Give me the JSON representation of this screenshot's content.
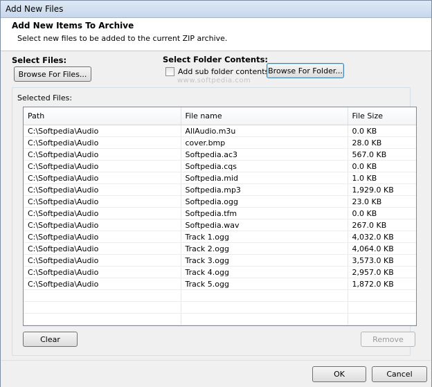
{
  "window": {
    "title": "Add New Files"
  },
  "header": {
    "title": "Add New Items To Archive",
    "subtitle": "Select new files to be added to the current ZIP archive."
  },
  "select_files": {
    "label": "Select Files:",
    "browse_files_label": "Browse For Files..."
  },
  "select_folder": {
    "label": "Select Folder Contents:",
    "subfolder_checkbox_label": "Add sub folder contents",
    "subfolder_checked": false,
    "browse_folder_label": "Browse For Folder..."
  },
  "watermark": "www.softpedia.com",
  "selected_files": {
    "label": "Selected Files:",
    "columns": [
      "Path",
      "File name",
      "File Size"
    ],
    "rows": [
      [
        "C:\\Softpedia\\Audio",
        "AllAudio.m3u",
        "0.0 KB"
      ],
      [
        "C:\\Softpedia\\Audio",
        "cover.bmp",
        "28.0 KB"
      ],
      [
        "C:\\Softpedia\\Audio",
        "Softpedia.ac3",
        "567.0 KB"
      ],
      [
        "C:\\Softpedia\\Audio",
        "Softpedia.cqs",
        "0.0 KB"
      ],
      [
        "C:\\Softpedia\\Audio",
        "Softpedia.mid",
        "1.0 KB"
      ],
      [
        "C:\\Softpedia\\Audio",
        "Softpedia.mp3",
        "1,929.0 KB"
      ],
      [
        "C:\\Softpedia\\Audio",
        "Softpedia.ogg",
        "23.0 KB"
      ],
      [
        "C:\\Softpedia\\Audio",
        "Softpedia.tfm",
        "0.0 KB"
      ],
      [
        "C:\\Softpedia\\Audio",
        "Softpedia.wav",
        "267.0 KB"
      ],
      [
        "C:\\Softpedia\\Audio",
        "Track 1.ogg",
        "4,032.0 KB"
      ],
      [
        "C:\\Softpedia\\Audio",
        "Track 2.ogg",
        "4,064.0 KB"
      ],
      [
        "C:\\Softpedia\\Audio",
        "Track 3.ogg",
        "3,573.0 KB"
      ],
      [
        "C:\\Softpedia\\Audio",
        "Track 4.ogg",
        "2,957.0 KB"
      ],
      [
        "C:\\Softpedia\\Audio",
        "Track 5.ogg",
        "1,872.0 KB"
      ]
    ],
    "clear_label": "Clear",
    "remove_label": "Remove"
  },
  "footer": {
    "ok_label": "OK",
    "cancel_label": "Cancel"
  }
}
